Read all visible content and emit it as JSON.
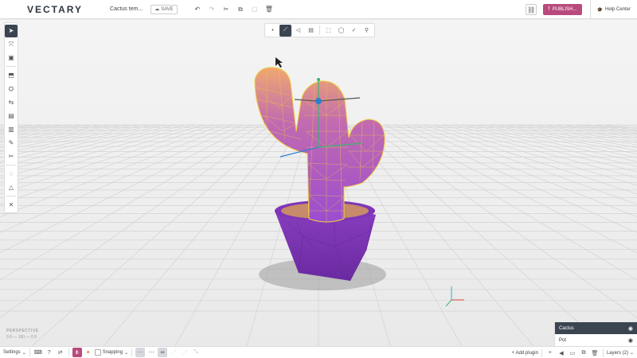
{
  "app": {
    "logo": "VECTARY",
    "doc_title": "Cactus tem...",
    "save_label": "SAVE",
    "publish_label": "PUBLISH...",
    "help_label": "Help Center"
  },
  "viewport": {
    "perspective_label": "PERSPECTIVE",
    "coords_label": "0 0 — 100 — 0 0",
    "icons": [
      "crosshair-icon"
    ]
  },
  "left_toolbar": {
    "icons": [
      "select-arrow-icon",
      "transform-icon",
      "cube-icon",
      "extrude-icon",
      "boolean-icon",
      "mirror-icon",
      "box-icon",
      "panel-icon",
      "pen-icon",
      "knife-icon",
      "light-icon",
      "triangle-icon",
      "collapse-icon"
    ]
  },
  "selection_toolbar": {
    "icons": [
      "object-mode-icon",
      "vertex-mode-icon",
      "edge-mode-icon",
      "face-mode-icon",
      "rect-select-icon",
      "lasso-icon",
      "brush-icon",
      "wand-icon"
    ]
  },
  "bottombar": {
    "settings_label": "Settings",
    "snapping_label": "Snapping",
    "add_plugin_label": "+ Add plugin",
    "layers_label": "Layers (2)"
  },
  "layers": [
    {
      "name": "Cactus",
      "selected": true
    },
    {
      "name": "Pot",
      "selected": false
    }
  ],
  "colors": {
    "accent": "#b84a7c",
    "selection": "#3b4552",
    "cactus_top": "#e8a070",
    "cactus_body": "#9b4dcf",
    "wire": "#f0d040"
  }
}
